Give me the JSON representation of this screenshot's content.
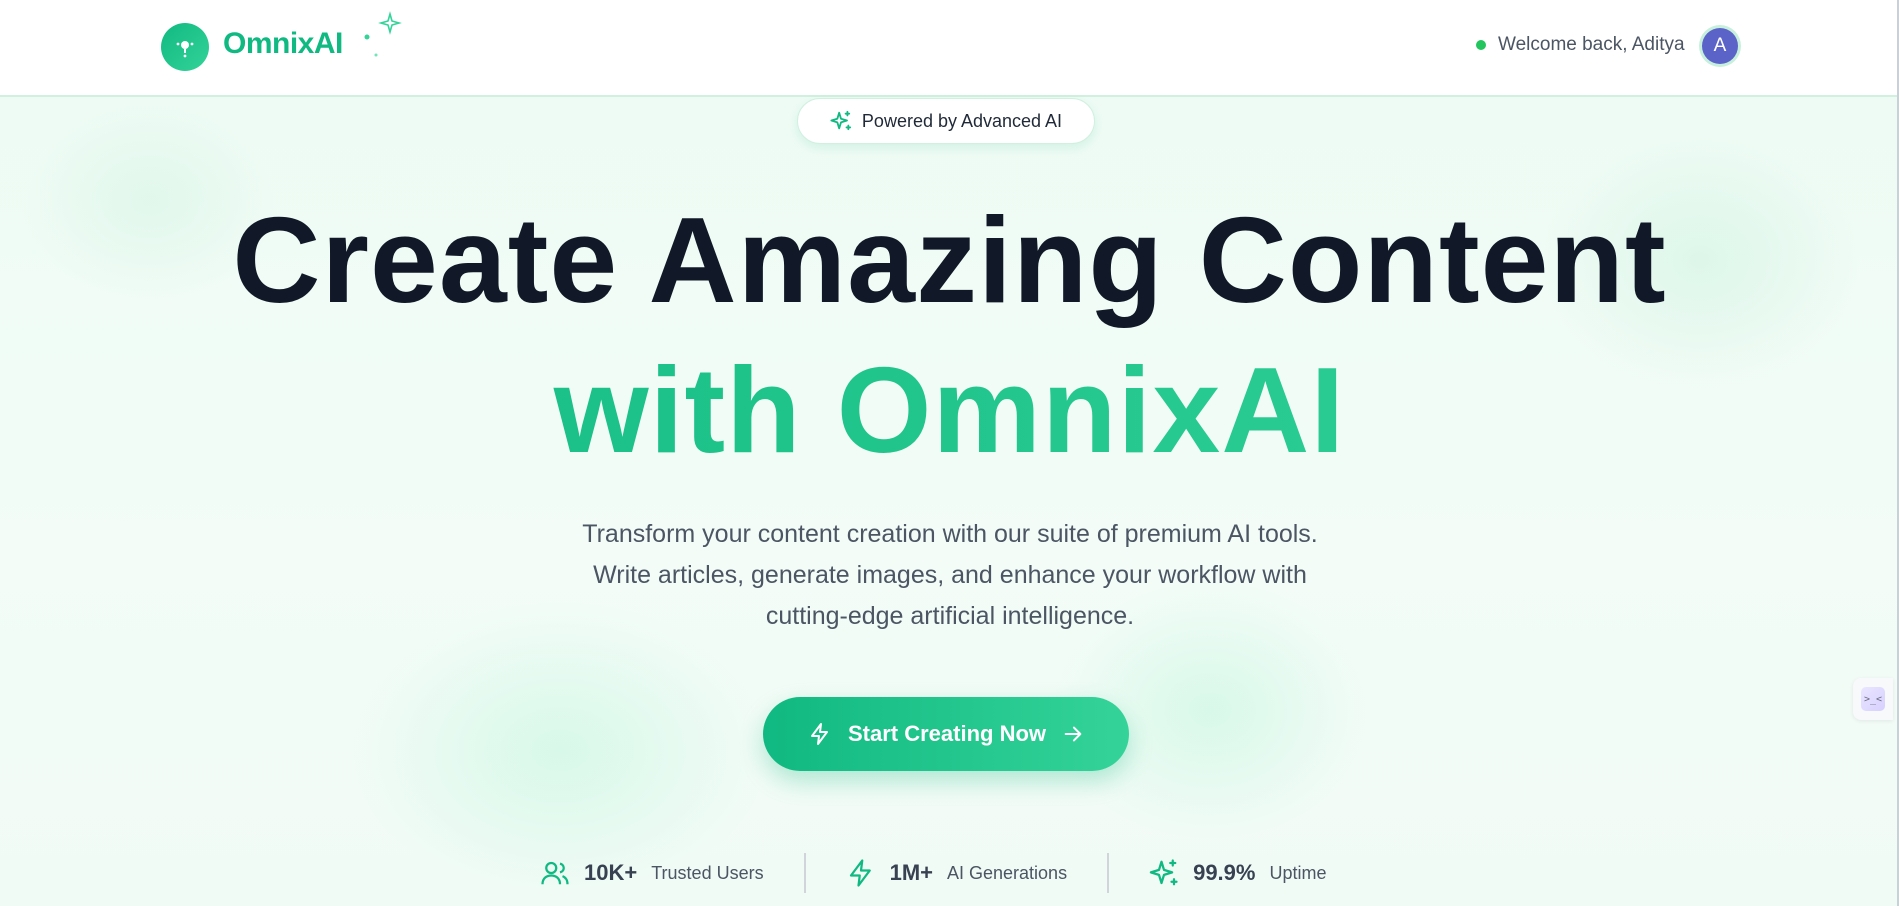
{
  "header": {
    "brand": "OmnixAI",
    "welcome_text": "Welcome back, Aditya",
    "avatar_initial": "A"
  },
  "hero": {
    "badge": "Powered by Advanced AI",
    "headline_line1": "Create Amazing Content",
    "headline_line2": "with OmnixAI",
    "subtitle_lines": [
      "Transform your content creation with our suite of premium AI tools.",
      "Write articles, generate images, and enhance your workflow with",
      "cutting-edge artificial intelligence."
    ],
    "cta_label": "Start Creating Now"
  },
  "stats": [
    {
      "icon": "users-icon",
      "value": "10K+",
      "label": "Trusted Users"
    },
    {
      "icon": "lightning-icon",
      "value": "1M+",
      "label": "AI Generations"
    },
    {
      "icon": "sparkles-icon",
      "value": "99.9%",
      "label": "Uptime"
    }
  ],
  "side_widget": {
    "glyph": ">_<"
  },
  "colors": {
    "accent": "#10b981",
    "accent_light": "#34d399",
    "text_dark": "#111827",
    "online": "#22c55e",
    "avatar_bg": "#5b63c9"
  }
}
